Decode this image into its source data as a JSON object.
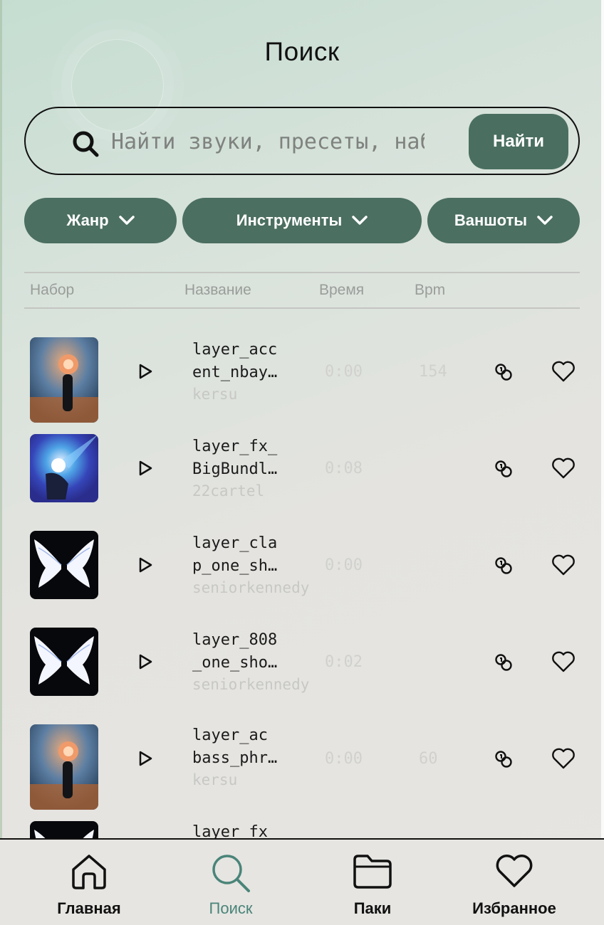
{
  "header": {
    "title": "Поиск"
  },
  "search": {
    "placeholder": "Найти звуки, пресеты, наборы",
    "button_label": "Найти"
  },
  "filters": [
    {
      "label": "Жанр"
    },
    {
      "label": "Инструменты"
    },
    {
      "label": "Ваншоты"
    }
  ],
  "table": {
    "headers": {
      "pack": "Набор",
      "name": "Название",
      "time": "Время",
      "bpm": "Bpm"
    },
    "rows": [
      {
        "name_line1": "layer_acc",
        "name_line2": "ent_nbay…",
        "author": "kersu",
        "time": "0:00",
        "bpm": "154",
        "art": "flower-figure"
      },
      {
        "name_line1": "layer_fx_",
        "name_line2": "BigBundl…",
        "author": "22cartel",
        "time": "0:08",
        "bpm": "",
        "art": "blue-light"
      },
      {
        "name_line1": "layer_cla",
        "name_line2": "p_one_sh…",
        "author": "seniorkennedy",
        "time": "0:00",
        "bpm": "",
        "art": "white-wings"
      },
      {
        "name_line1": "layer_808",
        "name_line2": "_one_sho…",
        "author": "seniorkennedy",
        "time": "0:02",
        "bpm": "",
        "art": "white-wings"
      },
      {
        "name_line1": "layer_ac",
        "name_line2": "bass_phr…",
        "author": "kersu",
        "time": "0:00",
        "bpm": "60",
        "art": "flower-figure"
      },
      {
        "name_line1": "layer_fx_",
        "name_line2": "",
        "author": "",
        "time": "",
        "bpm": "",
        "art": "white-wings"
      }
    ]
  },
  "nav": [
    {
      "label": "Главная",
      "icon": "home-icon"
    },
    {
      "label": "Поиск",
      "icon": "search-icon",
      "active": true
    },
    {
      "label": "Паки",
      "icon": "folder-icon"
    },
    {
      "label": "Избранное",
      "icon": "heart-icon"
    }
  ],
  "colors": {
    "accent": "#4b6f61",
    "active_nav": "#4a8479"
  }
}
